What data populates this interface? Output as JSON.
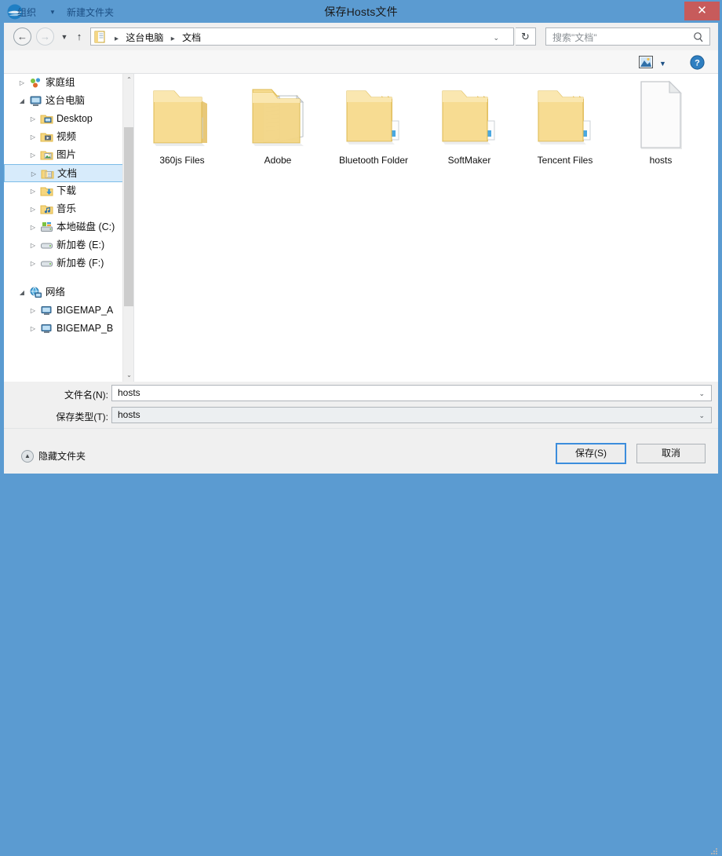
{
  "window": {
    "title": "保存Hosts文件",
    "app_icon": "app-logo-icon",
    "close_label": "✕",
    "frame_color": "#5b9bd1",
    "close_color": "#c75b5b"
  },
  "address_bar": {
    "back_icon": "←",
    "forward_icon": "→",
    "history_caret": "▼",
    "up_icon": "↑",
    "breadcrumb": [
      "这台电脑",
      "文档"
    ],
    "separator": "▸",
    "dropdown_caret": "⌄",
    "refresh_icon": "↻",
    "search_placeholder": "搜索\"文档\""
  },
  "toolbar": {
    "organize_label": "组织",
    "organize_caret": "▼",
    "new_folder_label": "新建文件夹",
    "view_icon": "view-pane-icon",
    "view_caret": "▼",
    "help_icon": "?"
  },
  "sidebar": {
    "expander_collapsed": "▷",
    "expander_expanded": "◢",
    "items": [
      {
        "label": "家庭组",
        "level": 0,
        "expander": "collapsed",
        "icon": "homegroup-icon",
        "selected": false
      },
      {
        "label": "这台电脑",
        "level": 0,
        "expander": "expanded",
        "icon": "computer-icon",
        "selected": false
      },
      {
        "label": "Desktop",
        "level": 1,
        "expander": "collapsed",
        "icon": "desktop-folder-icon",
        "selected": false
      },
      {
        "label": "视频",
        "level": 1,
        "expander": "collapsed",
        "icon": "videos-folder-icon",
        "selected": false
      },
      {
        "label": "图片",
        "level": 1,
        "expander": "collapsed",
        "icon": "pictures-folder-icon",
        "selected": false
      },
      {
        "label": "文档",
        "level": 1,
        "expander": "collapsed",
        "icon": "documents-folder-icon",
        "selected": true
      },
      {
        "label": "下载",
        "level": 1,
        "expander": "collapsed",
        "icon": "downloads-folder-icon",
        "selected": false
      },
      {
        "label": "音乐",
        "level": 1,
        "expander": "collapsed",
        "icon": "music-folder-icon",
        "selected": false
      },
      {
        "label": "本地磁盘 (C:)",
        "level": 1,
        "expander": "collapsed",
        "icon": "system-drive-icon",
        "selected": false
      },
      {
        "label": "新加卷 (E:)",
        "level": 1,
        "expander": "collapsed",
        "icon": "drive-icon",
        "selected": false
      },
      {
        "label": "新加卷 (F:)",
        "level": 1,
        "expander": "collapsed",
        "icon": "drive-icon",
        "selected": false
      },
      {
        "label": "",
        "level": 0,
        "expander": "none",
        "icon": "none",
        "selected": false
      },
      {
        "label": "网络",
        "level": 0,
        "expander": "expanded",
        "icon": "network-icon",
        "selected": false
      },
      {
        "label": "BIGEMAP_A",
        "level": 1,
        "expander": "collapsed",
        "icon": "network-computer-icon",
        "selected": false
      },
      {
        "label": "BIGEMAP_B",
        "level": 1,
        "expander": "collapsed",
        "icon": "network-computer-icon",
        "selected": false
      }
    ],
    "scroll_up_icon": "⌃",
    "scroll_down_icon": "⌄"
  },
  "files": [
    {
      "name": "360js Files",
      "type": "folder-plain"
    },
    {
      "name": "Adobe",
      "type": "folder-documents"
    },
    {
      "name": "Bluetooth Folder",
      "type": "folder-stack"
    },
    {
      "name": "SoftMaker",
      "type": "folder-stack"
    },
    {
      "name": "Tencent Files",
      "type": "folder-stack"
    },
    {
      "name": "hosts",
      "type": "file-blank"
    }
  ],
  "form": {
    "filename_label": "文件名(N):",
    "filename_value": "hosts",
    "savetype_label": "保存类型(T):",
    "savetype_value": "hosts",
    "dropdown_caret": "⌄"
  },
  "footer": {
    "hide_folders_label": "隐藏文件夹",
    "hide_folders_icon": "▲",
    "save_label": "保存(S)",
    "cancel_label": "取消"
  }
}
